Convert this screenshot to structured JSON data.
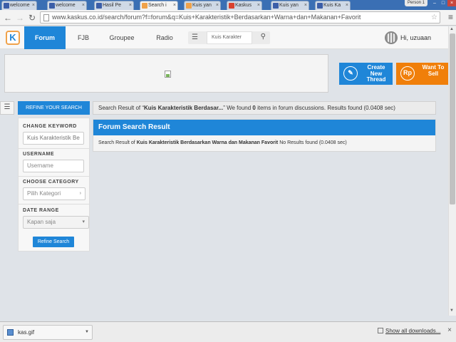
{
  "browser": {
    "tabs": [
      {
        "label": "welcome",
        "color": "#3b5ea8"
      },
      {
        "label": "welcome",
        "color": "#3b5ea8"
      },
      {
        "label": "Hasil Pe",
        "color": "#3b5ea8"
      },
      {
        "label": "Search i",
        "color": "#f0a24a"
      },
      {
        "label": "Kuis yan",
        "color": "#f0a24a"
      },
      {
        "label": "Kaskus",
        "color": "#d9412f"
      },
      {
        "label": "Kuis yan",
        "color": "#3b5ea8"
      },
      {
        "label": "Kuis Ka",
        "color": "#3b5ea8"
      }
    ],
    "active_tab": 3,
    "person": "Person 1",
    "url": "www.kaskus.co.id/search/forum?f=forum&q=Kuis+Karakteristik+Berdasarkan+Warna+dan+Makanan+Favorit"
  },
  "header": {
    "logo": "K",
    "nav": [
      "Forum",
      "FJB",
      "Groupee",
      "Radio"
    ],
    "search_placeholder": "Kuis Karakter",
    "greeting": "Hi, uzuaan"
  },
  "cta": {
    "create_thread": "Create New Thread",
    "want_to_sell": "Want To Sell",
    "rp_icon": "Rp"
  },
  "refine": {
    "title": "REFINE YOUR SEARCH",
    "keyword_label": "CHANGE KEYWORD",
    "keyword_value": "Kuis Karakteristik Be",
    "username_label": "USERNAME",
    "username_placeholder": "Username",
    "category_label": "CHOOSE CATEGORY",
    "category_value": "Pilih Kategori",
    "date_label": "DATE RANGE",
    "date_value": "Kapan saja",
    "button": "Refine Search"
  },
  "summary": {
    "prefix": "Search Result of “",
    "query": "Kuis Karakteristik Berdasar...",
    "middle": "” We found ",
    "count": "0",
    "suffix": " items in forum discussions. Results found (0.0408 sec)"
  },
  "result": {
    "title": "Forum Search Result",
    "prefix": "Search Result of ",
    "query": "Kuis Karakteristik Berdasarkan Warna dan Makanan Favorit",
    "suffix": " No Results found (0.0408 sec)"
  },
  "downloads": {
    "file": "kas.gif",
    "show_all": "Show all downloads..."
  },
  "colors": {
    "brand_blue": "#1f86d8",
    "orange": "#f07f0a",
    "logo_orange": "#f0a24a"
  }
}
